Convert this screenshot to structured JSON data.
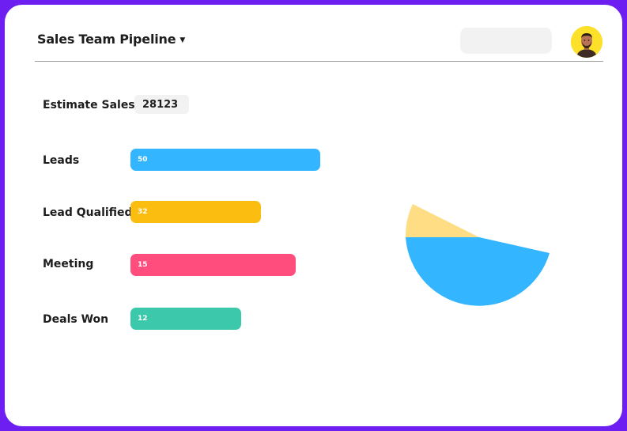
{
  "header": {
    "title": "Sales Team Pipeline",
    "dropdown_icon": "caret-down-icon",
    "search": {
      "value": "",
      "placeholder": ""
    },
    "avatar_icon": "user-avatar-icon"
  },
  "estimate": {
    "label": "Estimate Sales",
    "value": "28123"
  },
  "chart_data": {
    "type": "bar",
    "orientation": "horizontal",
    "categories": [
      "Leads",
      "Lead Qualified",
      "Meeting",
      "Deals Won"
    ],
    "values": [
      50,
      32,
      15,
      12
    ],
    "value_labels": [
      "50",
      "32",
      "15",
      "12"
    ],
    "colors": [
      "#33b5ff",
      "#fbbd0f",
      "#ff4d7e",
      "#3cc8ab"
    ]
  },
  "pie": {
    "type": "pie",
    "colors": [
      "#33b5ff",
      "#fedd85"
    ]
  }
}
